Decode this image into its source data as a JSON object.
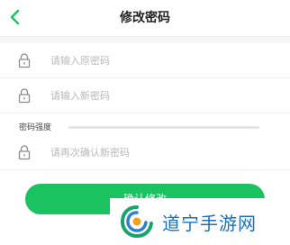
{
  "header": {
    "title": "修改密码",
    "back_icon": "chevron-left-icon"
  },
  "form": {
    "old_password_placeholder": "请输入原密码",
    "new_password_placeholder": "请输入新密码",
    "strength_label": "密码强度",
    "strength_level": 0,
    "confirm_password_placeholder": "请再次确认新密码",
    "lock_icon": "lock-icon"
  },
  "actions": {
    "confirm_label": "确认修改"
  },
  "watermark": {
    "text": "道宁手游网"
  },
  "colors": {
    "accent": "#1ac35f",
    "watermark_blue": "#1d6fb8"
  }
}
